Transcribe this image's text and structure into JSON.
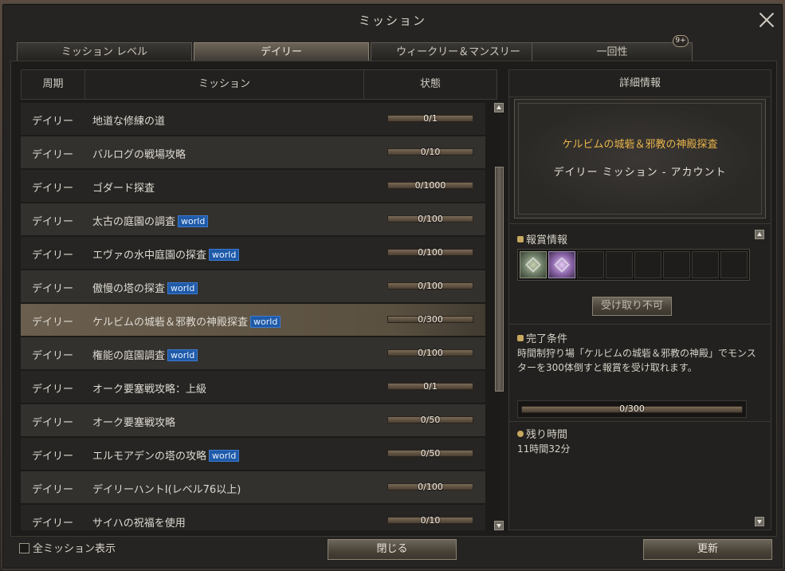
{
  "window": {
    "title": "ミッション"
  },
  "tabs": [
    {
      "label": "ミッション レベル",
      "active": false
    },
    {
      "label": "デイリー",
      "active": true
    },
    {
      "label": "ウィークリー＆マンスリー",
      "active": false
    },
    {
      "label": "一回性",
      "active": false,
      "badge": "9+"
    }
  ],
  "list": {
    "headers": {
      "period": "周期",
      "mission": "ミッション",
      "status": "状態"
    },
    "rows": [
      {
        "period": "デイリー",
        "name": "地道な修練の道",
        "world": false,
        "progress_text": "0/1",
        "progress": 0
      },
      {
        "period": "デイリー",
        "name": "バルログの戦場攻略",
        "world": false,
        "progress_text": "0/10",
        "progress": 0
      },
      {
        "period": "デイリー",
        "name": "ゴダード探査",
        "world": false,
        "progress_text": "0/1000",
        "progress": 0
      },
      {
        "period": "デイリー",
        "name": "太古の庭園の調査",
        "world": true,
        "progress_text": "0/100",
        "progress": 0
      },
      {
        "period": "デイリー",
        "name": "エヴァの水中庭園の探査",
        "world": true,
        "progress_text": "0/100",
        "progress": 0
      },
      {
        "period": "デイリー",
        "name": "傲慢の塔の探査",
        "world": true,
        "progress_text": "0/100",
        "progress": 0
      },
      {
        "period": "デイリー",
        "name": "ケルビムの城砦＆邪教の神殿探査",
        "world": true,
        "progress_text": "0/300",
        "progress": 0,
        "selected": true
      },
      {
        "period": "デイリー",
        "name": "権能の庭園調査",
        "world": true,
        "progress_text": "0/100",
        "progress": 0
      },
      {
        "period": "デイリー",
        "name": "オーク要塞戦攻略：上級",
        "world": false,
        "progress_text": "0/1",
        "progress": 0
      },
      {
        "period": "デイリー",
        "name": "オーク要塞戦攻略",
        "world": false,
        "progress_text": "0/50",
        "progress": 0
      },
      {
        "period": "デイリー",
        "name": "エルモアデンの塔の攻略",
        "world": true,
        "progress_text": "0/50",
        "progress": 0
      },
      {
        "period": "デイリー",
        "name": "デイリーハントⅠ(レベル76以上)",
        "world": false,
        "progress_text": "0/100",
        "progress": 0
      },
      {
        "period": "デイリー",
        "name": "サイハの祝福を使用",
        "world": false,
        "progress_text": "0/10",
        "progress": 0
      }
    ],
    "world_tag": "world"
  },
  "detail": {
    "header": "詳細情報",
    "mission_name": "ケルビムの城砦＆邪教の神殿探査",
    "mission_type": "デイリー ミッション - アカウント",
    "reward_label": "報賞情報",
    "claim_button": "受け取り不可",
    "condition_label": "完了条件",
    "condition_text": "時間制狩り場「ケルビムの城砦＆邪教の神殿」でモンスターを300体倒すと報賞を受け取れます。",
    "progress_text": "0/300",
    "progress": 0,
    "remain_label": "残り時間",
    "remain_time": "11時間32分",
    "reward_items": [
      "green-gem-icon",
      "purple-gem-icon"
    ]
  },
  "footer": {
    "show_all_label": "全ミッション表示",
    "close_button": "閉じる",
    "refresh_button": "更新"
  },
  "colors": {
    "accent_gold": "#e8b44a",
    "world_tag": "#1e5aa8"
  }
}
